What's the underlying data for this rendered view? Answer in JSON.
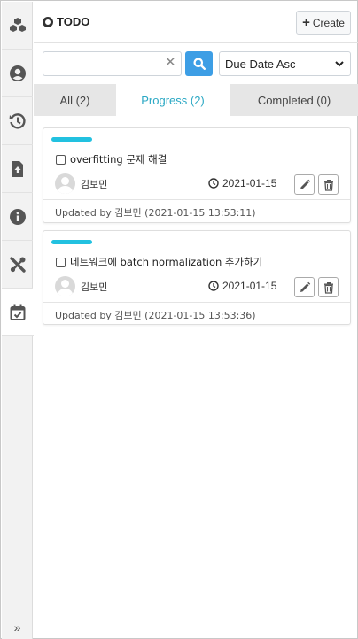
{
  "header": {
    "title": "TODO",
    "create_label": "Create"
  },
  "search": {
    "value": "",
    "placeholder": ""
  },
  "sort": {
    "selected": "Due Date Asc"
  },
  "tabs": [
    {
      "label": "All (2)"
    },
    {
      "label": "Progress (2)"
    },
    {
      "label": "Completed (0)"
    }
  ],
  "sidebar": {
    "items": [
      {
        "icon": "cubes-icon"
      },
      {
        "icon": "user-circle-icon"
      },
      {
        "icon": "history-icon"
      },
      {
        "icon": "file-upload-icon"
      },
      {
        "icon": "info-icon"
      },
      {
        "icon": "tools-icon"
      },
      {
        "icon": "calendar-check-icon"
      }
    ],
    "collapse": "»"
  },
  "todos": [
    {
      "title": "overfitting 문제 해결",
      "assignee": "김보민",
      "due": "2021-01-15",
      "updated": "Updated by 김보민 (2021-01-15 13:53:11)"
    },
    {
      "title": "네트워크에 batch normalization 추가하기",
      "assignee": "김보민",
      "due": "2021-01-15",
      "updated": "Updated by 김보민 (2021-01-15 13:53:36)"
    }
  ],
  "colors": {
    "accent": "#2aa8c4",
    "bar": "#22c1e0",
    "search_button": "#3d9ee5"
  }
}
